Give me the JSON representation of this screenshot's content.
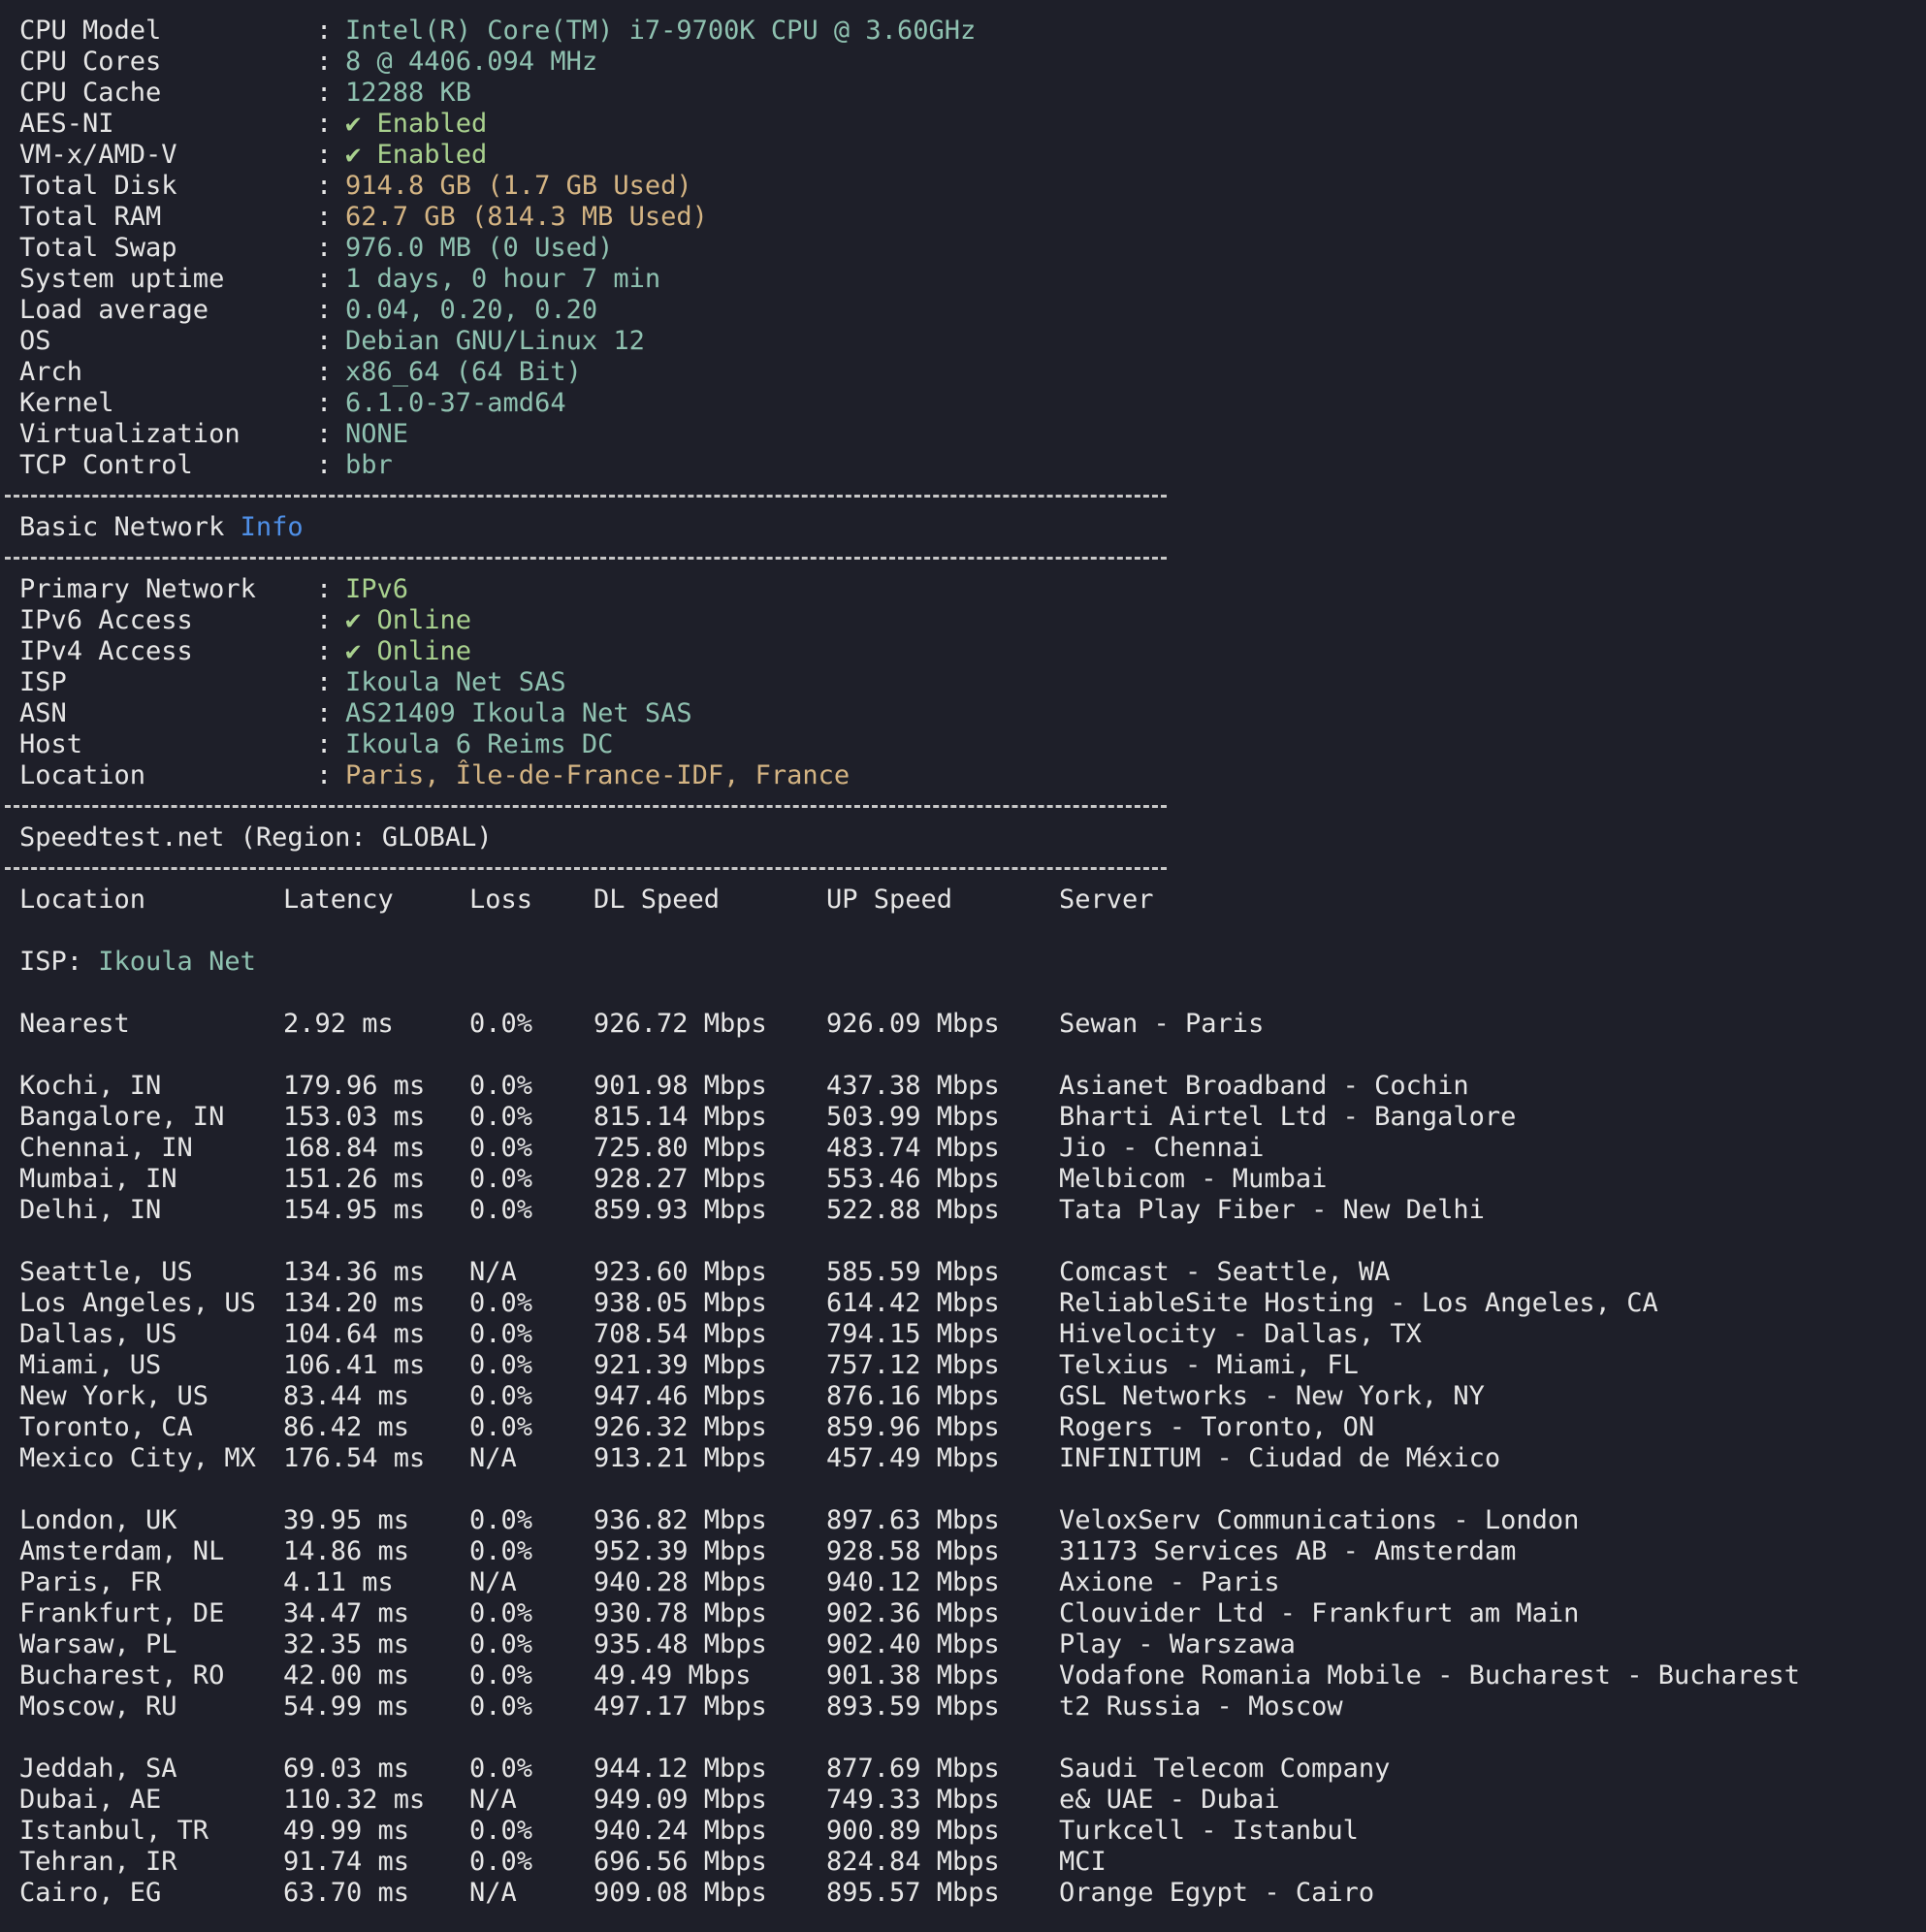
{
  "colors": {
    "background": "#1e1f29",
    "text": "#e6e6e6",
    "value_teal": "#8fc1b0",
    "value_gold": "#d4b483",
    "value_green": "#a9d18e",
    "accent_blue": "#4f8fe6"
  },
  "system": [
    {
      "label": "CPU Model",
      "value": "Intel(R) Core(TM) i7-9700K CPU @ 3.60GHz",
      "tone": "teal"
    },
    {
      "label": "CPU Cores",
      "value": "8 @ 4406.094 MHz",
      "tone": "teal"
    },
    {
      "label": "CPU Cache",
      "value": "12288 KB",
      "tone": "teal"
    },
    {
      "label": "AES-NI",
      "value": "✔ Enabled",
      "tone": "green"
    },
    {
      "label": "VM-x/AMD-V",
      "value": "✔ Enabled",
      "tone": "green"
    },
    {
      "label": "Total Disk",
      "value": "914.8 GB (1.7 GB Used)",
      "tone": "gold"
    },
    {
      "label": "Total RAM",
      "value": "62.7 GB (814.3 MB Used)",
      "tone": "gold"
    },
    {
      "label": "Total Swap",
      "value": "976.0 MB (0 Used)",
      "tone": "teal"
    },
    {
      "label": "System uptime",
      "value": "1 days, 0 hour 7 min",
      "tone": "teal"
    },
    {
      "label": "Load average",
      "value": "0.04, 0.20, 0.20",
      "tone": "teal"
    },
    {
      "label": "OS",
      "value": "Debian GNU/Linux 12",
      "tone": "teal"
    },
    {
      "label": "Arch",
      "value": "x86_64 (64 Bit)",
      "tone": "teal"
    },
    {
      "label": "Kernel",
      "value": "6.1.0-37-amd64",
      "tone": "teal"
    },
    {
      "label": "Virtualization",
      "value": "NONE",
      "tone": "teal"
    },
    {
      "label": "TCP Control",
      "value": "bbr",
      "tone": "teal"
    }
  ],
  "colon": ":",
  "network_section": {
    "title_prefix": "Basic Network ",
    "title_accent": "Info"
  },
  "network": [
    {
      "label": "Primary Network",
      "value": "IPv6",
      "tone": "green"
    },
    {
      "label": "IPv6 Access",
      "value": "✔ Online",
      "tone": "green"
    },
    {
      "label": "IPv4 Access",
      "value": "✔ Online",
      "tone": "green"
    },
    {
      "label": "ISP",
      "value": "Ikoula Net SAS",
      "tone": "teal"
    },
    {
      "label": "ASN",
      "value": "AS21409 Ikoula Net SAS",
      "tone": "teal"
    },
    {
      "label": "Host",
      "value": "Ikoula 6 Reims DC",
      "tone": "teal"
    },
    {
      "label": "Location",
      "value": "Paris, Île-de-France-IDF, France",
      "tone": "gold"
    }
  ],
  "speedtest": {
    "title": "Speedtest.net (Region: GLOBAL)",
    "headers": [
      "Location",
      "Latency",
      "Loss",
      "DL Speed",
      "UP Speed",
      "Server"
    ],
    "isp_label": "ISP: ",
    "isp_value": "Ikoula Net",
    "groups": [
      [
        [
          "Nearest",
          "2.92 ms",
          "0.0%",
          "926.72 Mbps",
          "926.09 Mbps",
          "Sewan - Paris"
        ]
      ],
      [
        [
          "Kochi, IN",
          "179.96 ms",
          "0.0%",
          "901.98 Mbps",
          "437.38 Mbps",
          "Asianet Broadband - Cochin"
        ],
        [
          "Bangalore, IN",
          "153.03 ms",
          "0.0%",
          "815.14 Mbps",
          "503.99 Mbps",
          "Bharti Airtel Ltd - Bangalore"
        ],
        [
          "Chennai, IN",
          "168.84 ms",
          "0.0%",
          "725.80 Mbps",
          "483.74 Mbps",
          "Jio - Chennai"
        ],
        [
          "Mumbai, IN",
          "151.26 ms",
          "0.0%",
          "928.27 Mbps",
          "553.46 Mbps",
          "Melbicom - Mumbai"
        ],
        [
          "Delhi, IN",
          "154.95 ms",
          "0.0%",
          "859.93 Mbps",
          "522.88 Mbps",
          "Tata Play Fiber - New Delhi"
        ]
      ],
      [
        [
          "Seattle, US",
          "134.36 ms",
          "N/A",
          "923.60 Mbps",
          "585.59 Mbps",
          "Comcast - Seattle, WA"
        ],
        [
          "Los Angeles, US",
          "134.20 ms",
          "0.0%",
          "938.05 Mbps",
          "614.42 Mbps",
          "ReliableSite Hosting - Los Angeles, CA"
        ],
        [
          "Dallas, US",
          "104.64 ms",
          "0.0%",
          "708.54 Mbps",
          "794.15 Mbps",
          "Hivelocity - Dallas, TX"
        ],
        [
          "Miami, US",
          "106.41 ms",
          "0.0%",
          "921.39 Mbps",
          "757.12 Mbps",
          "Telxius - Miami, FL"
        ],
        [
          "New York, US",
          "83.44 ms",
          "0.0%",
          "947.46 Mbps",
          "876.16 Mbps",
          "GSL Networks - New York, NY"
        ],
        [
          "Toronto, CA",
          "86.42 ms",
          "0.0%",
          "926.32 Mbps",
          "859.96 Mbps",
          "Rogers - Toronto, ON"
        ],
        [
          "Mexico City, MX",
          "176.54 ms",
          "N/A",
          "913.21 Mbps",
          "457.49 Mbps",
          "INFINITUM - Ciudad de México"
        ]
      ],
      [
        [
          "London, UK",
          "39.95 ms",
          "0.0%",
          "936.82 Mbps",
          "897.63 Mbps",
          "VeloxServ Communications - London"
        ],
        [
          "Amsterdam, NL",
          "14.86 ms",
          "0.0%",
          "952.39 Mbps",
          "928.58 Mbps",
          "31173 Services AB - Amsterdam"
        ],
        [
          "Paris, FR",
          "4.11 ms",
          "N/A",
          "940.28 Mbps",
          "940.12 Mbps",
          "Axione - Paris"
        ],
        [
          "Frankfurt, DE",
          "34.47 ms",
          "0.0%",
          "930.78 Mbps",
          "902.36 Mbps",
          "Clouvider Ltd - Frankfurt am Main"
        ],
        [
          "Warsaw, PL",
          "32.35 ms",
          "0.0%",
          "935.48 Mbps",
          "902.40 Mbps",
          "Play - Warszawa"
        ],
        [
          "Bucharest, RO",
          "42.00 ms",
          "0.0%",
          "49.49 Mbps",
          "901.38 Mbps",
          "Vodafone Romania Mobile - Bucharest - Bucharest"
        ],
        [
          "Moscow, RU",
          "54.99 ms",
          "0.0%",
          "497.17 Mbps",
          "893.59 Mbps",
          "t2 Russia - Moscow"
        ]
      ],
      [
        [
          "Jeddah, SA",
          "69.03 ms",
          "0.0%",
          "944.12 Mbps",
          "877.69 Mbps",
          "Saudi Telecom Company"
        ],
        [
          "Dubai, AE",
          "110.32 ms",
          "N/A",
          "949.09 Mbps",
          "749.33 Mbps",
          "e& UAE - Dubai"
        ],
        [
          "Istanbul, TR",
          "49.99 ms",
          "0.0%",
          "940.24 Mbps",
          "900.89 Mbps",
          "Turkcell - Istanbul"
        ],
        [
          "Tehran, IR",
          "91.74 ms",
          "0.0%",
          "696.56 Mbps",
          "824.84 Mbps",
          "MCI"
        ],
        [
          "Cairo, EG",
          "63.70 ms",
          "N/A",
          "909.08 Mbps",
          "895.57 Mbps",
          "Orange Egypt - Cairo"
        ]
      ]
    ]
  }
}
